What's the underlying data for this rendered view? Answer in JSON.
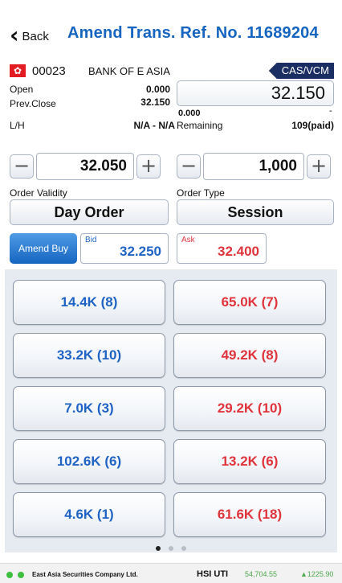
{
  "header": {
    "back_icon": "chevron-left",
    "back_label": "Back",
    "title": "Amend Trans. Ref. No. 11689204"
  },
  "stock": {
    "flag_icon": "hk-flag",
    "code": "00023",
    "name": "BANK OF E ASIA",
    "tag": "CAS/VCM",
    "open_label": "Open",
    "open_value": "0.000",
    "prev_close_label": "Prev.Close",
    "prev_close_value": "32.150",
    "lh_label": "L/H",
    "lh_value": "N/A - N/A",
    "last_price": "32.150",
    "change_value": "0.000",
    "change_dash": "-",
    "remaining_label": "Remaining",
    "remaining_value": "109(paid)"
  },
  "order": {
    "price": "32.050",
    "quantity": "1,000",
    "minus_symbol": "−",
    "plus_symbol": "+",
    "validity_label": "Order Validity",
    "validity_value": "Day Order",
    "type_label": "Order Type",
    "type_value": "Session"
  },
  "quote_bar": {
    "amend_label": "Amend Buy",
    "bid_label": "Bid",
    "bid_value": "32.250",
    "ask_label": "Ask",
    "ask_value": "32.400"
  },
  "depth": {
    "bids": [
      "14.4K (8)",
      "33.2K (10)",
      "7.0K (3)",
      "102.6K (6)",
      "4.6K (1)"
    ],
    "asks": [
      "65.0K (7)",
      "49.2K (8)",
      "29.2K (10)",
      "13.2K (6)",
      "61.6K (18)"
    ]
  },
  "pager": {
    "pages": 3,
    "active": 0
  },
  "footer": {
    "company": "East Asia Securities Company Ltd.",
    "index_name": "HSI UTI",
    "index_value": "54,704.55",
    "index_change": "▲1225.90"
  },
  "colors": {
    "accent": "#1665c0",
    "bid": "#1f63c4",
    "ask": "#e0343c",
    "up": "#4ea84e",
    "tag_bg": "#1a2e63"
  }
}
